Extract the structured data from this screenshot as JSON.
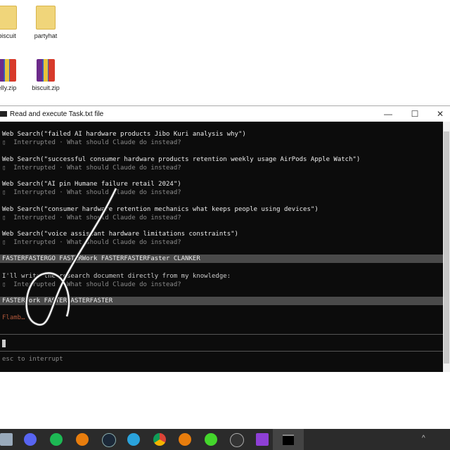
{
  "desktop": {
    "icons": [
      {
        "label": "biscuit",
        "type": "folder"
      },
      {
        "label": "partyhat",
        "type": "folder"
      },
      {
        "label": "elly.zip",
        "type": "zip"
      },
      {
        "label": "biscuit.zip",
        "type": "zip"
      }
    ]
  },
  "window": {
    "title": "Read and execute Task.txt file",
    "minimize": "—",
    "maximize": "☐",
    "close": "✕"
  },
  "terminal": {
    "entries": [
      {
        "tool": "Web Search(\"failed AI hardware products Jibo Kuri analysis why\")",
        "status": "▯  Interrupted · What should Claude do instead?"
      },
      {
        "tool": "Web Search(\"successful consumer hardware products retention weekly usage AirPods Apple Watch\")",
        "status": "▯  Interrupted · What should Claude do instead?"
      },
      {
        "tool": "Web Search(\"AI pin Humane failure retail 2024\")",
        "status": "▯  Interrupted · What should Claude do instead?"
      },
      {
        "tool": "Web Search(\"consumer hardware retention mechanics what keeps people using devices\")",
        "status": "▯  Interrupted · What should Claude do instead?"
      },
      {
        "tool": "Web Search(\"voice assistant hardware limitations constraints\")",
        "status": "▯  Interrupted · What should Claude do instead?"
      }
    ],
    "user_msg_1": "FASTERFASTERGO FASTERWork FASTERFASTERFaster CLANKER",
    "reply": "I'll write the research document directly from my knowledge:",
    "reply_status": "▯  Interrupted · What should Claude do instead?",
    "user_msg_2": "FASTERWork FASTERFASTERFASTER",
    "spinner": "Flamb…",
    "footer": "esc to interrupt"
  },
  "taskbar": {
    "apps": [
      "file-explorer",
      "discord",
      "spotify",
      "blender",
      "steam",
      "telegram",
      "chrome",
      "blender-2",
      "razer",
      "obs",
      "purple-folder",
      "terminal"
    ]
  }
}
